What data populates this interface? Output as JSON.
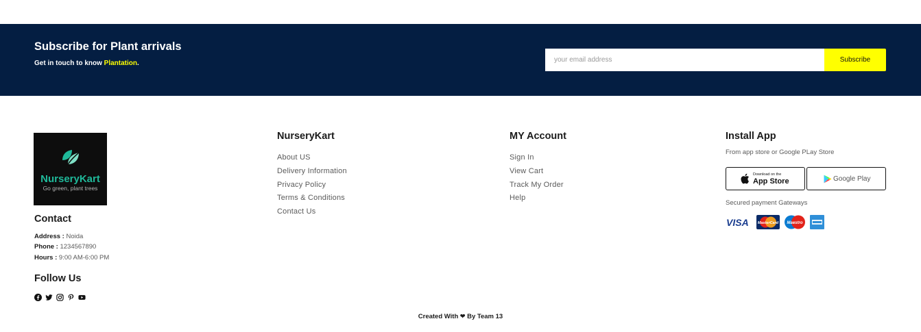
{
  "subscribe": {
    "title": "Subscribe for Plant arrivals",
    "text_prefix": "Get in touch to know ",
    "text_highlight": "Plantation",
    "text_suffix": ".",
    "email_placeholder": "your email address",
    "email_value": "",
    "button_label": "Subscribe",
    "colors": {
      "band": "#041e42",
      "accent": "#ffff00"
    }
  },
  "brand": {
    "logo_name": "NurseryKart",
    "logo_tagline": "Go green, plant trees",
    "logo_colors": {
      "leaf": "#1fb99a",
      "background": "#0d0d0d"
    }
  },
  "contact": {
    "title": "Contact",
    "address_label": "Address :",
    "address_value": "Noida",
    "phone_label": "Phone :",
    "phone_value": "1234567890",
    "hours_label": "Hours :",
    "hours_value": "9:00 AM-6:00 PM"
  },
  "follow": {
    "title": "Follow Us",
    "icons": [
      "facebook-icon",
      "twitter-icon",
      "instagram-icon",
      "pinterest-icon",
      "youtube-icon"
    ]
  },
  "nurserykart": {
    "title": "NurseryKart",
    "links": [
      "About US",
      "Delivery Information",
      "Privacy Policy",
      "Terms & Conditions",
      "Contact Us"
    ]
  },
  "account": {
    "title": "MY Account",
    "links": [
      "Sign In",
      "View Cart",
      "Track My Order",
      "Help"
    ]
  },
  "install": {
    "title": "Install App",
    "note": "From app store or Google PLay Store",
    "app_store_small": "Download on the",
    "app_store_big": "App Store",
    "google_play": "Google Play",
    "payment_note": "Secured payment Gateways",
    "payment_methods": [
      "VISA",
      "MasterCard",
      "Maestro",
      "American Express"
    ]
  },
  "credit": {
    "prefix": "Created With ",
    "suffix": " By Team 13"
  }
}
